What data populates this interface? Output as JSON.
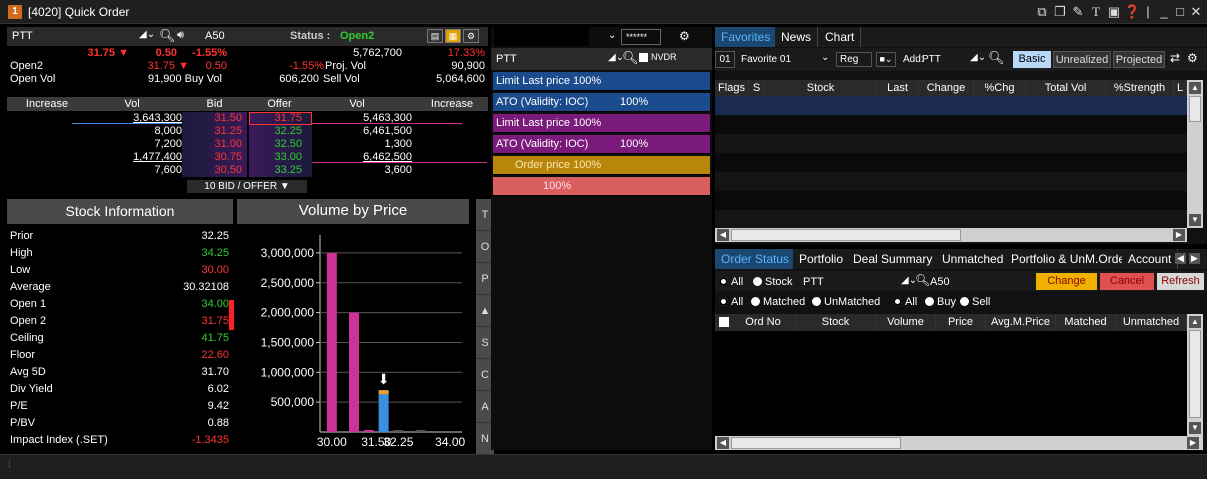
{
  "window": {
    "title": "[4020] Quick Order",
    "badge": "1"
  },
  "quote": {
    "symbol": "PTT",
    "code_label": "A50",
    "status_label": "Status : ",
    "status_value": "Open2",
    "last": "31.75 ▼",
    "change": "0.50",
    "pct": "-1.55%",
    "volume": "5,762,700",
    "pct_strength": "17.33%",
    "open2_label": "Open2",
    "open2_last": "31.75 ▼",
    "open2_change": "0.50",
    "open2_pct": "-1.55%",
    "projvol_label": "Proj. Vol",
    "projvol": "90,900",
    "openvol_label": "Open Vol",
    "buy_vol": "91,900 Buy Vol",
    "sell_vol_val": "606,200",
    "sell_vol_label": "Sell Vol",
    "sell_total": "5,064,600"
  },
  "book": {
    "headers": [
      "Increase",
      "Vol",
      "Bid",
      "Offer",
      "Vol",
      "Increase"
    ],
    "rows": [
      {
        "bid_vol": "3,643,300",
        "bid": "31.50",
        "offer": "31.75",
        "offer_vol": "5,463,300"
      },
      {
        "bid_vol": "8,000",
        "bid": "31.25",
        "offer": "32.25",
        "offer_vol": "6,461,500"
      },
      {
        "bid_vol": "7,200",
        "bid": "31.00",
        "offer": "32.50",
        "offer_vol": "1,300"
      },
      {
        "bid_vol": "1,477,400",
        "bid": "30.75",
        "offer": "33.00",
        "offer_vol": "6,462,500"
      },
      {
        "bid_vol": "7,600",
        "bid": "30.50",
        "offer": "33.25",
        "offer_vol": "3,600"
      }
    ],
    "footer": "10 BID / OFFER ▼"
  },
  "stock_info": {
    "title": "Stock Information",
    "items": [
      {
        "label": "Prior",
        "value": "32.25",
        "color": "#ffffff"
      },
      {
        "label": "High",
        "value": "34.25",
        "color": "#33cc33"
      },
      {
        "label": "Low",
        "value": "30.00",
        "color": "#ff3333"
      },
      {
        "label": "Average",
        "value": "30.32108",
        "color": "#ffffff"
      },
      {
        "label": "Open 1",
        "value": "34.00",
        "color": "#33cc33"
      },
      {
        "label": "Open 2",
        "value": "31.75",
        "color": "#ff3333"
      },
      {
        "label": "Ceiling",
        "value": "41.75",
        "color": "#33cc33"
      },
      {
        "label": "Floor",
        "value": "22.60",
        "color": "#ff3333"
      },
      {
        "label": "Avg 5D",
        "value": "31.70",
        "color": "#ffffff"
      },
      {
        "label": "Div Yield",
        "value": "6.02",
        "color": "#ffffff"
      },
      {
        "label": "P/E",
        "value": "9.42",
        "color": "#ffffff"
      },
      {
        "label": "P/BV",
        "value": "0.88",
        "color": "#ffffff"
      },
      {
        "label": "Impact Index (.SET)",
        "value": "-1.3435",
        "color": "#ff3333"
      }
    ]
  },
  "side_buttons": [
    "T",
    "O",
    "P",
    "▲",
    "S",
    "C",
    "A",
    "N"
  ],
  "chart_data": {
    "type": "bar",
    "title": "Volume by Price",
    "xticks": [
      "30.00",
      "31.50",
      "32.25",
      "34.00"
    ],
    "yticks": [
      "500,000",
      "1,000,000",
      "1,500,000",
      "2,000,000",
      "2,500,000",
      "3,000,000"
    ],
    "ylim": [
      0,
      3300000
    ],
    "bars": [
      {
        "price": 30.0,
        "value": 3000000,
        "color": "#cc3399"
      },
      {
        "price": 30.75,
        "value": 2000000,
        "color": "#cc3399"
      },
      {
        "price": 31.25,
        "value": 25000,
        "color": "#cc3399"
      },
      {
        "price": 31.75,
        "value": 700000,
        "color": "#3a8fe0",
        "cap": "#f0a020"
      },
      {
        "price": 32.25,
        "value": 8000,
        "color": "#555555"
      },
      {
        "price": 33.0,
        "value": 8000,
        "color": "#555555"
      }
    ],
    "marker": "⬇"
  },
  "order": {
    "symbol": "PTT",
    "pin": "******",
    "nvdr_label": "NVDR",
    "buttons": [
      {
        "main": "Limit  Last price 100%",
        "sub": "",
        "bg": "#1a4b8c"
      },
      {
        "main": "ATO (Validity: IOC)",
        "sub": "100%",
        "bg": "#1a4b8c"
      },
      {
        "main": "Limit  Last price 100%",
        "sub": "",
        "bg": "#7a1a7a"
      },
      {
        "main": "ATO (Validity: IOC)",
        "sub": "100%",
        "bg": "#7a1a7a"
      },
      {
        "main": "Order price 100%",
        "sub": "",
        "bg": "#b8860b"
      },
      {
        "main": "100%",
        "sub": "",
        "bg": "#d95f5f"
      }
    ]
  },
  "favorites": {
    "tabs": [
      "Favorites",
      "News",
      "Chart"
    ],
    "list_no": "01",
    "list_name": "Favorite 01",
    "reg": "Reg",
    "add_label": "Add:",
    "add_value": "PTT",
    "view_tabs": [
      "Basic",
      "Unrealized",
      "Projected"
    ],
    "columns": [
      "Flags",
      "S",
      "Stock",
      "Last",
      "Change",
      "%Chg",
      "Total Vol",
      "%Strength",
      "L"
    ]
  },
  "orders": {
    "tabs": [
      "Order Status",
      "Portfolio",
      "Deal Summary",
      "Unmatched",
      "Portfolio & UnM.Order",
      "Account"
    ],
    "filter_all": "All",
    "filter_stock": "Stock",
    "stock_value": "PTT",
    "code_value": "A50",
    "change_btn": "Change",
    "cancel_btn": "Cancel",
    "refresh_btn": "Refresh",
    "status_filters": [
      "All",
      "Matched",
      "UnMatched"
    ],
    "side_filters": [
      "All",
      "Buy",
      "Sell"
    ],
    "columns": [
      "Ord No",
      "Stock",
      "Volume",
      "Price",
      "Avg.M.Price",
      "Matched",
      "Unmatched"
    ]
  }
}
